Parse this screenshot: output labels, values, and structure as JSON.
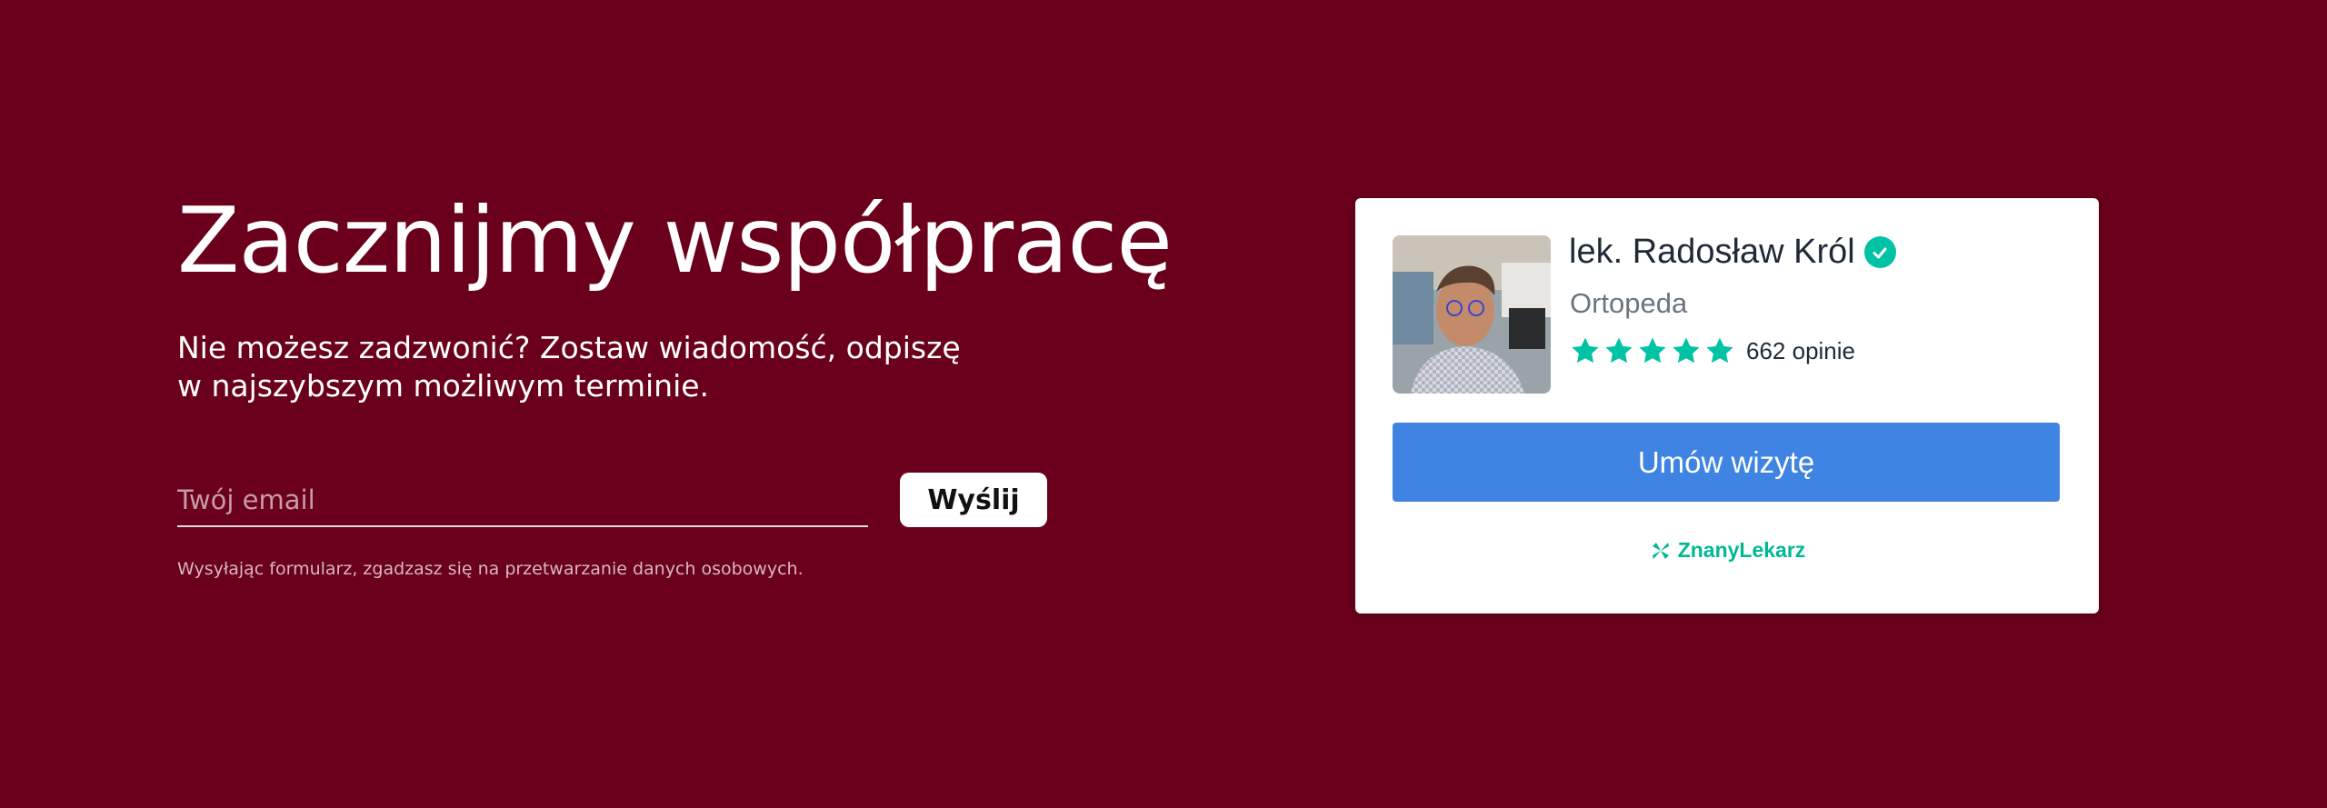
{
  "contact": {
    "title": "Zacznijmy współpracę",
    "subtitle_line1": "Nie możesz zadzwonić? Zostaw wiadomość, odpiszę",
    "subtitle_line2": "w najszybszym możliwym terminie.",
    "email_placeholder": "Twój email",
    "email_value": "",
    "submit_label": "Wyślij",
    "consent_text": "Wysyłając formularz, zgadzasz się na przetwarzanie danych osobowych."
  },
  "doctor_card": {
    "name": "lek. Radosław Król",
    "specialty": "Ortopeda",
    "rating_stars": 5,
    "reviews_label": "662 opinie",
    "book_button_label": "Umów wizytę",
    "brand": "ZnanyLekarz"
  },
  "colors": {
    "background": "#6a001b",
    "accent_green": "#00c3a5",
    "book_button": "#3f84e2"
  }
}
